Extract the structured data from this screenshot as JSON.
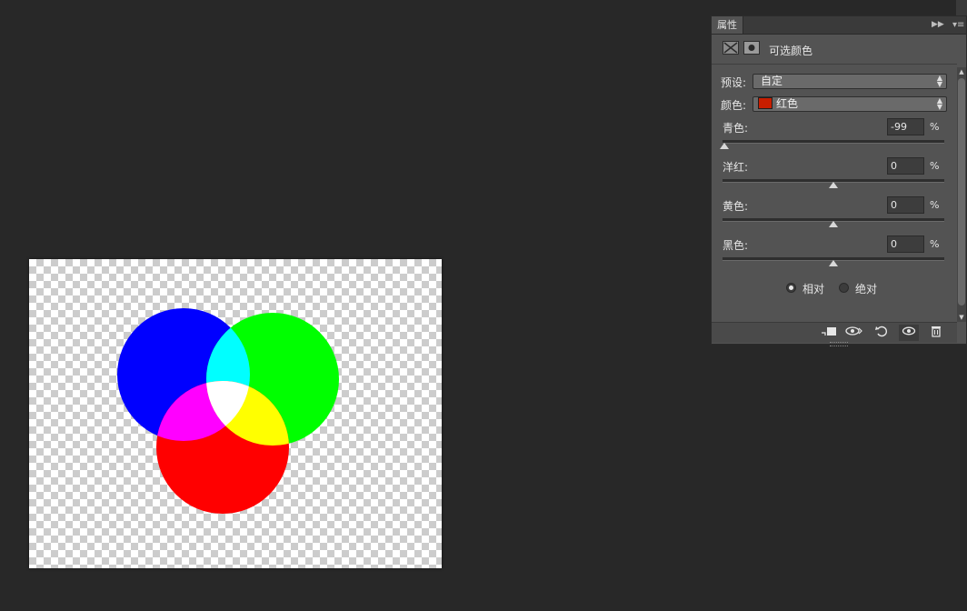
{
  "panel": {
    "tab_label": "属性",
    "adjustment_title": "可选颜色",
    "preset_label": "预设:",
    "preset_value": "自定",
    "color_label": "颜色:",
    "color_value": "红色",
    "color_swatch": "#c81e00",
    "sliders": [
      {
        "label": "青色:",
        "value": "-99",
        "unit": "%",
        "level": -99
      },
      {
        "label": "洋红:",
        "value": "0",
        "unit": "%",
        "level": 0
      },
      {
        "label": "黄色:",
        "value": "0",
        "unit": "%",
        "level": 0
      },
      {
        "label": "黑色:",
        "value": "0",
        "unit": "%",
        "level": 0
      }
    ],
    "method_options": [
      {
        "label": "相对",
        "checked": true
      },
      {
        "label": "绝对",
        "checked": false
      }
    ],
    "footer_icons": [
      "clip-to-layer-icon",
      "view-previous-state-icon",
      "reset-icon",
      "visibility-eye-icon",
      "trash-icon"
    ]
  },
  "canvas": {
    "circle_colors": {
      "blue": "#0000ff",
      "green": "#00ff00",
      "red": "#ff0000",
      "cyan": "#00ffff",
      "magenta": "#ff00ff",
      "yellow": "#ffff00",
      "white": "#ffffff"
    }
  }
}
